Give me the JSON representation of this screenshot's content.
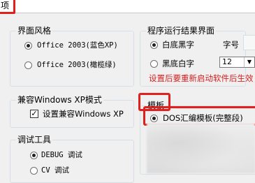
{
  "window": {
    "title_fragment": "项"
  },
  "interface_style": {
    "legend": "界面风格",
    "options": [
      {
        "label": "Office 2003(蓝色XP)",
        "selected": true
      },
      {
        "label": "Office 2003(橄榄绿)",
        "selected": false
      }
    ]
  },
  "run_result": {
    "legend": "程序运行结果界面",
    "options": [
      {
        "label": "白底黑字",
        "selected": true
      },
      {
        "label": "黑底白字",
        "selected": false
      }
    ],
    "font_size_label": "字号",
    "font_size_value": "12",
    "notice": "设置后要重新启动软件后生效",
    "notice_color": "#d42020"
  },
  "compat": {
    "legend": "兼容Windows XP模式",
    "checkbox_label": "设置兼容Windows XP",
    "checked": true
  },
  "template": {
    "legend": "模板",
    "option_label": "DOS汇编模板(完整段)",
    "selected": true
  },
  "debug_tool": {
    "legend": "调试工具",
    "options": [
      {
        "label": "DEBUG 调试",
        "selected": true
      },
      {
        "label": "CV 调试",
        "selected": false
      }
    ]
  },
  "colors": {
    "highlight": "#e0201c",
    "group_border": "#d5dfe5",
    "background": "#f0f0f0"
  },
  "icons": {
    "checkbox_mark": "check-icon",
    "dropdown": "chevron-down-icon"
  }
}
